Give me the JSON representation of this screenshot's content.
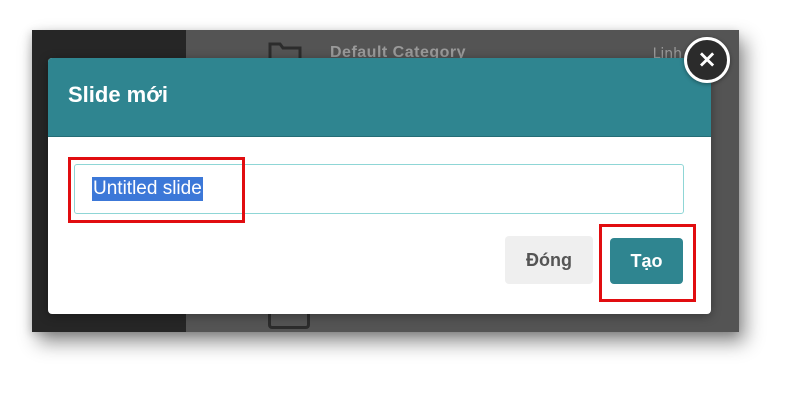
{
  "background": {
    "category_label": "Default Category",
    "right_label": "Linh hoạt"
  },
  "modal": {
    "title": "Slide mới",
    "input_value": "Untitled slide",
    "close_label": "Đóng",
    "create_label": "Tạo",
    "close_icon": "×"
  },
  "colors": {
    "header": "#2f8590",
    "selection": "#3c78d8",
    "highlight": "#e10d10"
  }
}
